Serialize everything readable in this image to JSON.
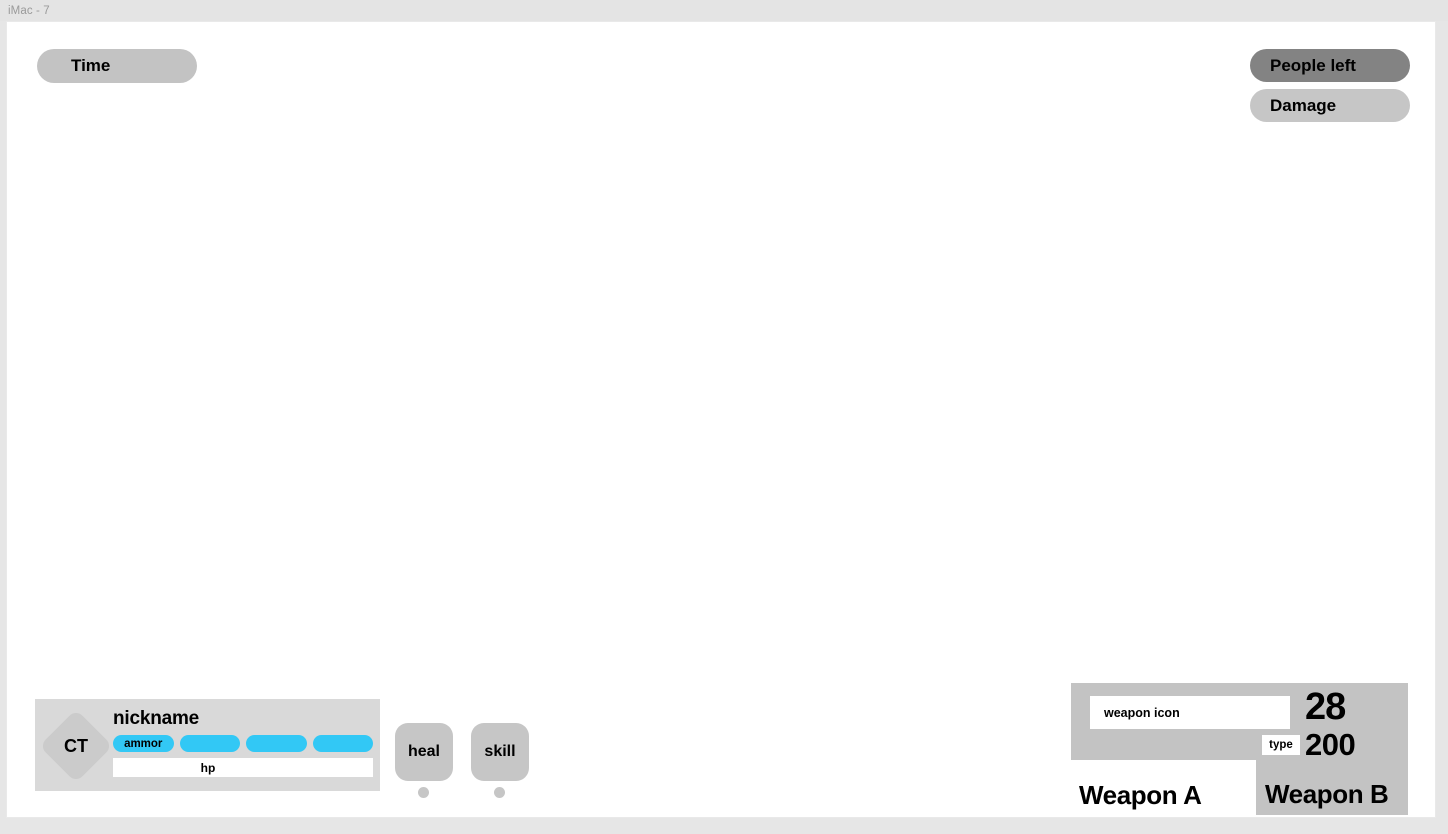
{
  "window": {
    "title": "iMac - 7"
  },
  "hud": {
    "top_left": {
      "time_label": "Time"
    },
    "top_right": {
      "people_left_label": "People left",
      "damage_label": "Damage"
    }
  },
  "player_card": {
    "team_badge": "CT",
    "nickname": "nickname",
    "ammo_label": "ammor",
    "ammo_segments": [
      "ammor",
      "",
      "",
      ""
    ],
    "hp_label": "hp"
  },
  "actions": {
    "heal_label": "heal",
    "skill_label": "skill"
  },
  "weapons": {
    "icon_label": "weapon icon",
    "magazine_count": "28",
    "reserve_ammo": "200",
    "type_label": "type",
    "weapon_a_label": "Weapon A",
    "weapon_b_label": "Weapon B"
  },
  "colors": {
    "accent_cyan": "#32c8f5",
    "panel_gray": "#c3c3c3",
    "card_gray": "#d9d9d9",
    "active_gray": "#838383",
    "canvas_white": "#ffffff",
    "desktop_gray": "#e6e6e6"
  }
}
